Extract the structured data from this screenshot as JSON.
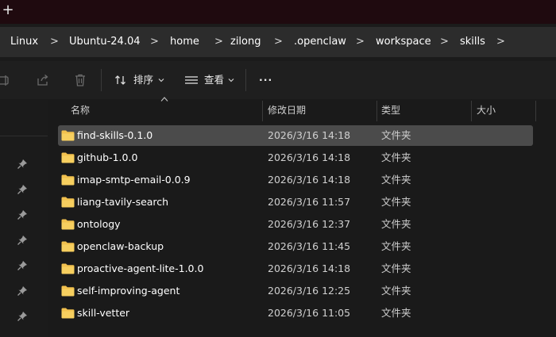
{
  "tab_strip": {
    "new_tab_glyph": "+"
  },
  "breadcrumb": {
    "segments": [
      "Linux",
      "Ubuntu-24.04",
      "home",
      "zilong",
      ".openclaw",
      "workspace",
      "skills"
    ],
    "separator": ">"
  },
  "toolbar": {
    "sort_label": "排序",
    "view_label": "查看",
    "more_glyph": "···"
  },
  "columns": {
    "name": "名称",
    "modified": "修改日期",
    "type": "类型",
    "size": "大小"
  },
  "files": [
    {
      "name": "find-skills-0.1.0",
      "modified": "2026/3/16 14:18",
      "type": "文件夹",
      "selected": true
    },
    {
      "name": "github-1.0.0",
      "modified": "2026/3/16 14:18",
      "type": "文件夹"
    },
    {
      "name": "imap-smtp-email-0.0.9",
      "modified": "2026/3/16 14:18",
      "type": "文件夹"
    },
    {
      "name": "liang-tavily-search",
      "modified": "2026/3/16 11:57",
      "type": "文件夹"
    },
    {
      "name": "ontology",
      "modified": "2026/3/16 12:37",
      "type": "文件夹"
    },
    {
      "name": "openclaw-backup",
      "modified": "2026/3/16 11:45",
      "type": "文件夹"
    },
    {
      "name": "proactive-agent-lite-1.0.0",
      "modified": "2026/3/16 14:18",
      "type": "文件夹"
    },
    {
      "name": "self-improving-agent",
      "modified": "2026/3/16 12:25",
      "type": "文件夹"
    },
    {
      "name": "skill-vetter",
      "modified": "2026/3/16 11:05",
      "type": "文件夹"
    }
  ],
  "colors": {
    "tab_strip_bg": "#1f0a0f",
    "selected_row": "#4b4b4b",
    "folder": "#f2c14e"
  }
}
